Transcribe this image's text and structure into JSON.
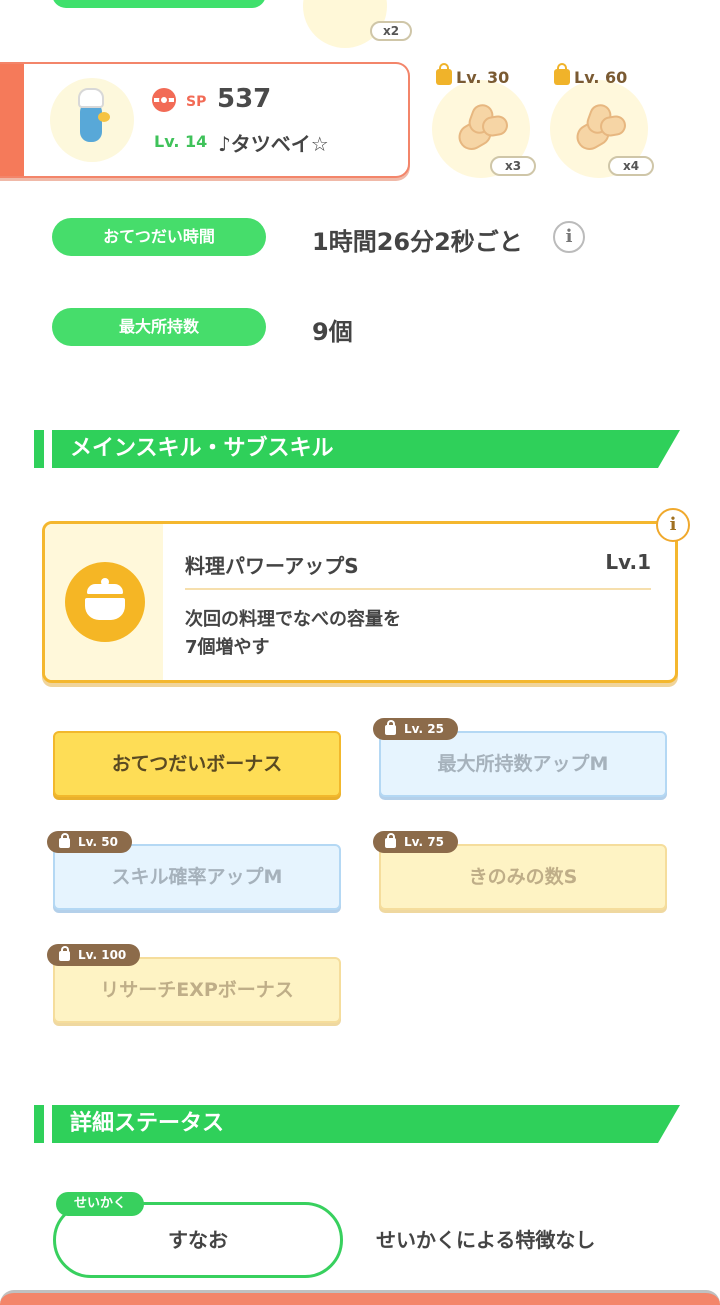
{
  "top": {
    "item_count": "x2"
  },
  "pokemon": {
    "sp_label": "SP",
    "sp_value": "537",
    "level": "Lv. 14",
    "name": "♪タツベイ☆"
  },
  "ingredients": [
    {
      "unlock_level": "Lv. 30",
      "count": "x3",
      "icon": "ginger-icon",
      "locked": true
    },
    {
      "unlock_level": "Lv. 60",
      "count": "x4",
      "icon": "ginger-icon",
      "locked": true
    }
  ],
  "stats": {
    "help_time_label": "おてつだい時間",
    "help_time_value": "1時間26分2秒ごと",
    "info_glyph": "i",
    "max_carry_label": "最大所持数",
    "max_carry_value": "9個"
  },
  "skills_section": {
    "title": "メインスキル・サブスキル",
    "main_skill": {
      "name": "料理パワーアップS",
      "level": "Lv.1",
      "description_line1": "次回の料理でなべの容量を",
      "description_line2": "7個増やす",
      "icon": "pot-icon"
    },
    "sub_skills": [
      {
        "label": "おてつだいボーナス",
        "unlock": "",
        "style": "active"
      },
      {
        "label": "最大所持数アップM",
        "unlock": "Lv. 25",
        "style": "blue"
      },
      {
        "label": "スキル確率アップM",
        "unlock": "Lv. 50",
        "style": "blue"
      },
      {
        "label": "きのみの数S",
        "unlock": "Lv. 75",
        "style": "yellow"
      },
      {
        "label": "リサーチEXPボーナス",
        "unlock": "Lv. 100",
        "style": "yellow"
      }
    ]
  },
  "details_section": {
    "title": "詳細ステータス",
    "nature_tag": "せいかく",
    "nature_value": "すなお",
    "nature_effect": "せいかくによる特徴なし"
  },
  "colors": {
    "green": "#2fd05a",
    "accent": "#f57a5a",
    "gold": "#f4b72e"
  }
}
